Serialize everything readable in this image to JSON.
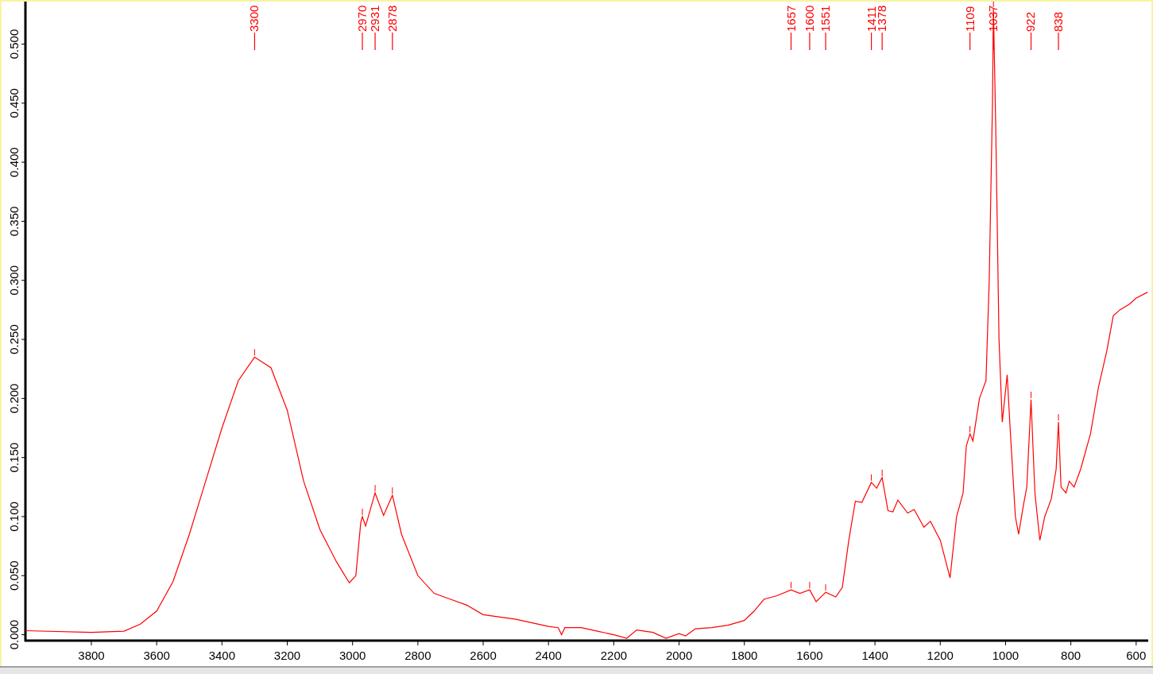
{
  "chart_data": {
    "type": "line",
    "xlim": [
      4002,
      563
    ],
    "ylim": [
      -0.005,
      0.536
    ],
    "xticks": [
      3800,
      3600,
      3400,
      3200,
      3000,
      2800,
      2600,
      2400,
      2200,
      2000,
      1800,
      1600,
      1400,
      1200,
      1000,
      800,
      600
    ],
    "yticks": [
      {
        "value": 0,
        "label": "0.000"
      },
      {
        "value": 0.05,
        "label": "0.050"
      },
      {
        "value": 0.1,
        "label": "0.100"
      },
      {
        "value": 0.15,
        "label": "0.150"
      },
      {
        "value": 0.2,
        "label": "0.200"
      },
      {
        "value": 0.25,
        "label": "0.250"
      },
      {
        "value": 0.3,
        "label": "0.300"
      },
      {
        "value": 0.35,
        "label": "0.350"
      },
      {
        "value": 0.4,
        "label": "0.400"
      },
      {
        "value": 0.45,
        "label": "0.450"
      },
      {
        "value": 0.5,
        "label": "0.500"
      }
    ],
    "x": [
      4002,
      3800,
      3700,
      3650,
      3600,
      3550,
      3500,
      3450,
      3400,
      3350,
      3300,
      3250,
      3200,
      3150,
      3100,
      3050,
      3010,
      2990,
      2975,
      2970,
      2960,
      2931,
      2905,
      2878,
      2850,
      2800,
      2750,
      2700,
      2650,
      2600,
      2500,
      2450,
      2400,
      2370,
      2360,
      2350,
      2300,
      2250,
      2200,
      2160,
      2130,
      2080,
      2040,
      2000,
      1980,
      1950,
      1900,
      1850,
      1800,
      1770,
      1740,
      1700,
      1657,
      1630,
      1600,
      1580,
      1551,
      1520,
      1500,
      1480,
      1460,
      1440,
      1411,
      1395,
      1378,
      1360,
      1345,
      1330,
      1300,
      1280,
      1250,
      1230,
      1200,
      1170,
      1150,
      1130,
      1120,
      1109,
      1100,
      1080,
      1060,
      1050,
      1040,
      1037,
      1030,
      1020,
      1010,
      995,
      985,
      970,
      960,
      945,
      935,
      922,
      910,
      895,
      880,
      860,
      845,
      838,
      830,
      815,
      805,
      790,
      770,
      740,
      715,
      690,
      670,
      650,
      620,
      600,
      565
    ],
    "series": [
      {
        "color": "#ff0000",
        "values": [
          0.0034,
          0.002,
          0.003,
          0.009,
          0.02,
          0.045,
          0.085,
          0.13,
          0.175,
          0.215,
          0.235,
          0.226,
          0.19,
          0.13,
          0.089,
          0.062,
          0.044,
          0.05,
          0.095,
          0.1,
          0.092,
          0.12,
          0.101,
          0.118,
          0.085,
          0.05,
          0.035,
          0.03,
          0.025,
          0.017,
          0.013,
          0.01,
          0.007,
          0.006,
          0.0,
          0.006,
          0.006,
          0.003,
          0.0,
          -0.003,
          0.004,
          0.002,
          -0.003,
          0.001,
          -0.001,
          0.005,
          0.006,
          0.008,
          0.012,
          0.02,
          0.03,
          0.033,
          0.038,
          0.035,
          0.038,
          0.028,
          0.036,
          0.032,
          0.04,
          0.08,
          0.113,
          0.112,
          0.129,
          0.124,
          0.133,
          0.105,
          0.104,
          0.114,
          0.103,
          0.106,
          0.091,
          0.096,
          0.08,
          0.048,
          0.1,
          0.12,
          0.16,
          0.17,
          0.164,
          0.2,
          0.215,
          0.3,
          0.45,
          0.53,
          0.43,
          0.25,
          0.18,
          0.22,
          0.17,
          0.1,
          0.085,
          0.11,
          0.125,
          0.199,
          0.12,
          0.08,
          0.1,
          0.115,
          0.14,
          0.18,
          0.125,
          0.12,
          0.13,
          0.125,
          0.14,
          0.17,
          0.21,
          0.24,
          0.27,
          0.275,
          0.28,
          0.285,
          0.29
        ]
      }
    ],
    "annotations": [
      {
        "x": 3300,
        "text": "3300"
      },
      {
        "x": 2970,
        "text": "2970"
      },
      {
        "x": 2931,
        "text": "2931"
      },
      {
        "x": 2878,
        "text": "2878"
      },
      {
        "x": 1657,
        "text": "1657"
      },
      {
        "x": 1600,
        "text": "1600"
      },
      {
        "x": 1551,
        "text": "1551"
      },
      {
        "x": 1411,
        "text": "1411"
      },
      {
        "x": 1378,
        "text": "1378"
      },
      {
        "x": 1109,
        "text": "1109"
      },
      {
        "x": 1037,
        "text": "1037"
      },
      {
        "x": 922,
        "text": "922"
      },
      {
        "x": 838,
        "text": "838"
      }
    ]
  }
}
